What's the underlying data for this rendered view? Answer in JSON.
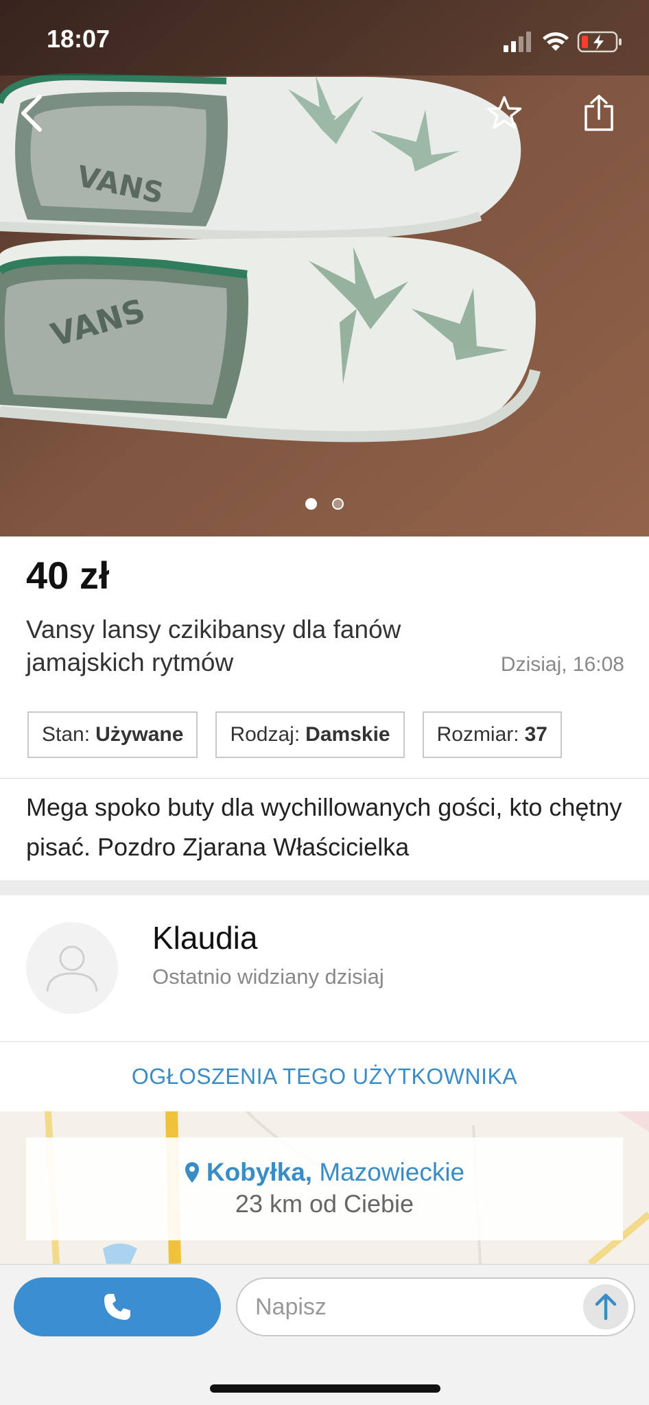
{
  "status_bar": {
    "time": "18:07"
  },
  "hero": {
    "back_icon": "chevron-left-icon",
    "favorite_icon": "star-outline-icon",
    "share_icon": "share-icon",
    "image_count": 2,
    "active_image": 1
  },
  "listing": {
    "price": "40 zł",
    "title": "Vansy lansy czikibansy dla fanów jamajskich rytmów",
    "posted": "Dzisiaj, 16:08",
    "tags": [
      {
        "label": "Stan:",
        "value": "Używane"
      },
      {
        "label": "Rodzaj:",
        "value": "Damskie"
      },
      {
        "label": "Rozmiar:",
        "value": "37"
      }
    ],
    "description": "Mega spoko buty dla wychillowanych gości, kto chętny pisać. Pozdro Zjarana Właścicielka"
  },
  "seller": {
    "name": "Klaudia",
    "last_seen": "Ostatnio widziany dzisiaj",
    "ads_link": "OGŁOSZENIA TEGO UŻYTKOWNIKA"
  },
  "location": {
    "city": "Kobyłka,",
    "region": "Mazowieckie",
    "distance": "23 km od Ciebie"
  },
  "bottom_bar": {
    "message_placeholder": "Napisz"
  },
  "colors": {
    "accent": "#3b8ed0",
    "link": "#3a8cc6"
  }
}
